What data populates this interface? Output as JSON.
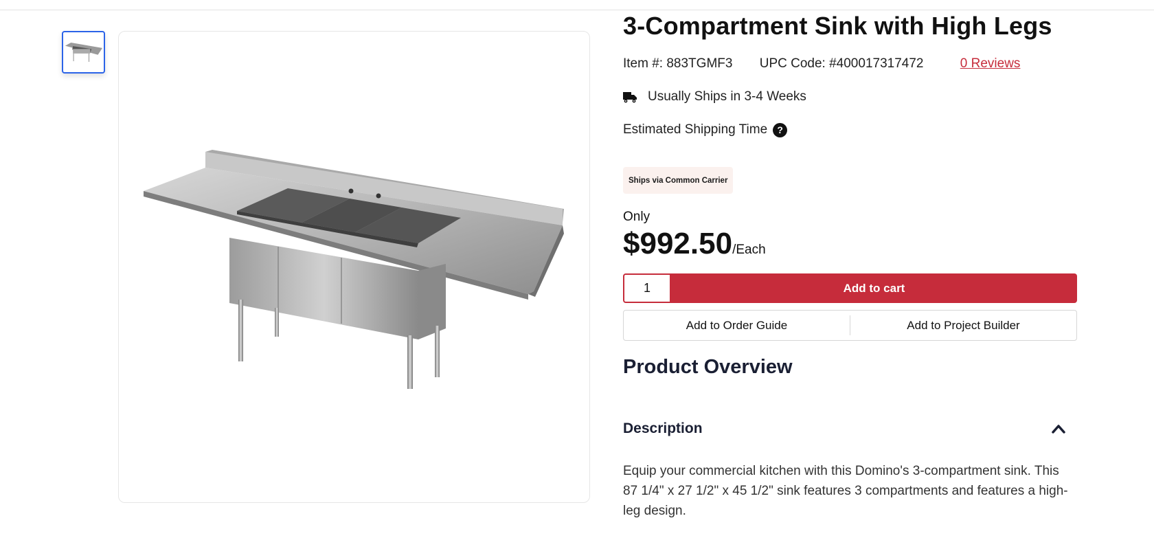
{
  "product": {
    "title": "3-Compartment Sink with High Legs",
    "item_label": "Item #: 883TGMF3",
    "upc_label": "UPC Code: #400017317472",
    "reviews_link": "0 Reviews",
    "shipping_time": "Usually Ships in 3-4 Weeks",
    "estimated_shipping": "Estimated Shipping Time",
    "help_glyph": "?",
    "carrier_badge": "Ships via Common Carrier",
    "price_prefix": "Only",
    "price": "$992.50",
    "price_unit": "/Each"
  },
  "purchase": {
    "quantity": "1",
    "add_to_cart": "Add to cart",
    "add_to_order_guide": "Add to Order Guide",
    "add_to_project_builder": "Add to Project Builder"
  },
  "overview": {
    "title": "Product Overview",
    "description_heading": "Description",
    "description_text": "Equip your commercial kitchen with this Domino's 3-compartment sink. This 87 1/4\" x 27 1/2\" x 45 1/2\" sink features 3 compartments and features a high-leg design."
  },
  "icons": {
    "truck": "truck-icon",
    "help": "question-circle-icon",
    "chevron": "chevron-up-icon"
  },
  "colors": {
    "accent_red": "#c62c3b",
    "thumb_border_blue": "#2b63e8",
    "badge_bg": "#fbf1ee",
    "heading_navy": "#1a1f33"
  }
}
